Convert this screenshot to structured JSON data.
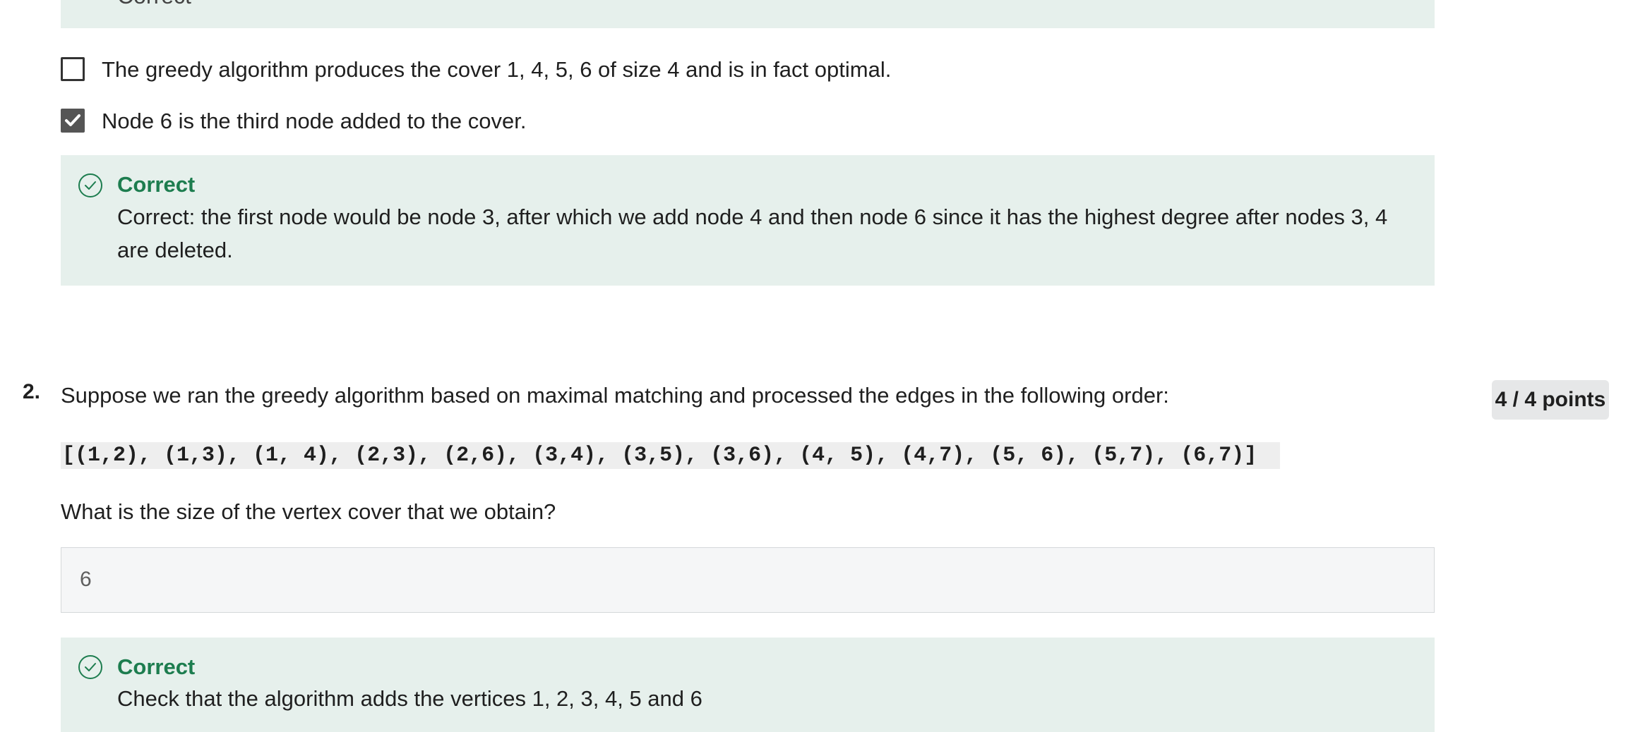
{
  "q1": {
    "top_feedback_text": "Correct",
    "options": [
      {
        "label": "The greedy algorithm produces the cover 1, 4, 5, 6 of size 4 and is in fact optimal.",
        "checked": false
      },
      {
        "label": "Node 6 is the third node added to the cover.",
        "checked": true
      }
    ],
    "feedback": {
      "title": "Correct",
      "body": "Correct: the first node would be node 3, after which we add node 4 and then node 6 since it has the highest degree after nodes 3, 4 are deleted."
    }
  },
  "q2": {
    "number": "2.",
    "text": "Suppose we ran the greedy algorithm based on maximal matching and processed the edges in the following order:",
    "points": "4 / 4 points",
    "code": "[(1,2), (1,3), (1, 4), (2,3), (2,6), (3,4), (3,5), (3,6), (4, 5), (4,7), (5, 6), (5,7), (6,7)]",
    "prompt": "What is the size of the vertex cover that we obtain?",
    "answer": "6",
    "feedback": {
      "title": "Correct",
      "body": "Check that the algorithm adds the vertices 1, 2, 3, 4, 5 and 6"
    }
  },
  "colors": {
    "feedback_bg": "#e6f0ec",
    "correct_green": "#1d7d4f",
    "points_bg": "#e6e7e8"
  },
  "icons": {
    "feedback": "check-circle-icon",
    "checkbox_checked": "checkmark-icon"
  }
}
